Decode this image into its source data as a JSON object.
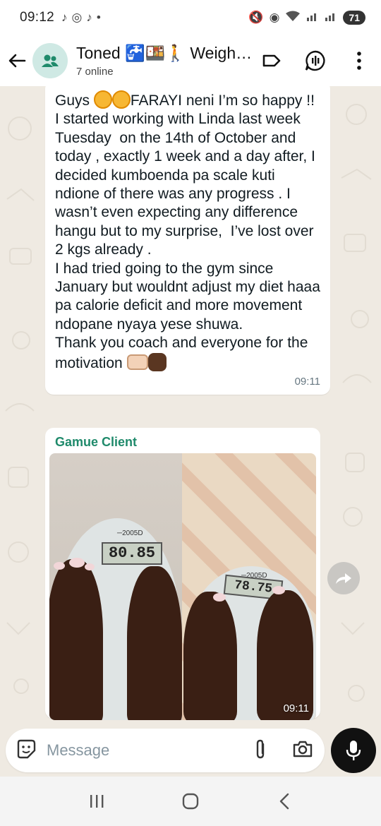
{
  "status_bar": {
    "time": "09:12",
    "battery": "71"
  },
  "header": {
    "title": "Toned 🚰🍱🚶 Weight...",
    "subtitle": "7 online"
  },
  "messages": [
    {
      "lines": [
        "Guys ",
        "FARAYI neni I’m so happy !!\nI started working with Linda last week Tuesday  on the 14th of October and today , exactly 1 week and a day after, I decided kumboenda pa scale kuti ndione of there was any progress . I wasn’t even expecting any difference hangu but to my surprise,  I’ve lost over 2 kgs already .\nI had tried going to the gym since January but wouldnt adjust my diet haaa pa calorie deficit and more movement  ndopane nyaya yese shuwa.\nThank you coach and everyone for the motivation "
      ],
      "time": "09:11"
    },
    {
      "sender": "Gamue Client",
      "photo": {
        "left_reading": "80.85",
        "right_reading": "78.75",
        "left_model": "─2005D",
        "right_model": "─2005D"
      },
      "time": "09:11"
    }
  ],
  "composer": {
    "placeholder": "Message"
  }
}
